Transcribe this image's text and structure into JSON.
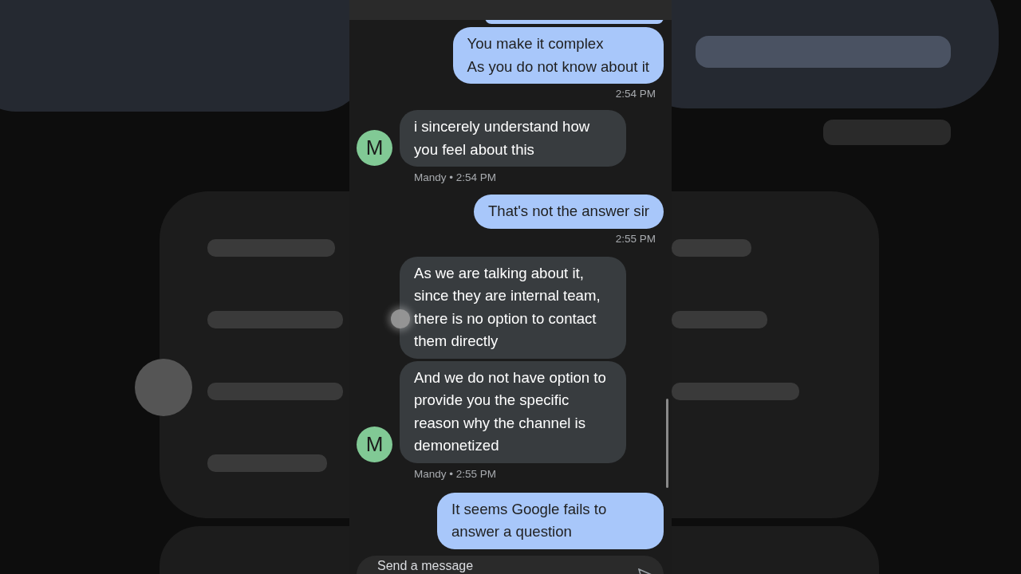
{
  "messages": [
    {
      "kind": "outgoing",
      "partial": true
    },
    {
      "kind": "outgoing",
      "bubbles": [
        "You make it complex\nAs you do not know about it"
      ],
      "time": "2:54 PM"
    },
    {
      "kind": "incoming",
      "bubbles": [
        "i sincerely understand how you feel about this"
      ],
      "avatar": "M",
      "meta": "Mandy • 2:54 PM"
    },
    {
      "kind": "outgoing",
      "bubbles": [
        "That's not the answer sir"
      ],
      "time": "2:55 PM"
    },
    {
      "kind": "incoming",
      "bubbles": [
        "As we are talking about it, since they are internal team, there is no option to contact them directly",
        "And we do not have option to provide you the specific reason why the channel is demonetized"
      ],
      "avatar": "M",
      "meta": "Mandy • 2:55 PM"
    },
    {
      "kind": "outgoing",
      "bubbles": [
        "It seems Google fails to answer a question"
      ]
    }
  ],
  "composer": {
    "placeholder": "Send a message"
  }
}
